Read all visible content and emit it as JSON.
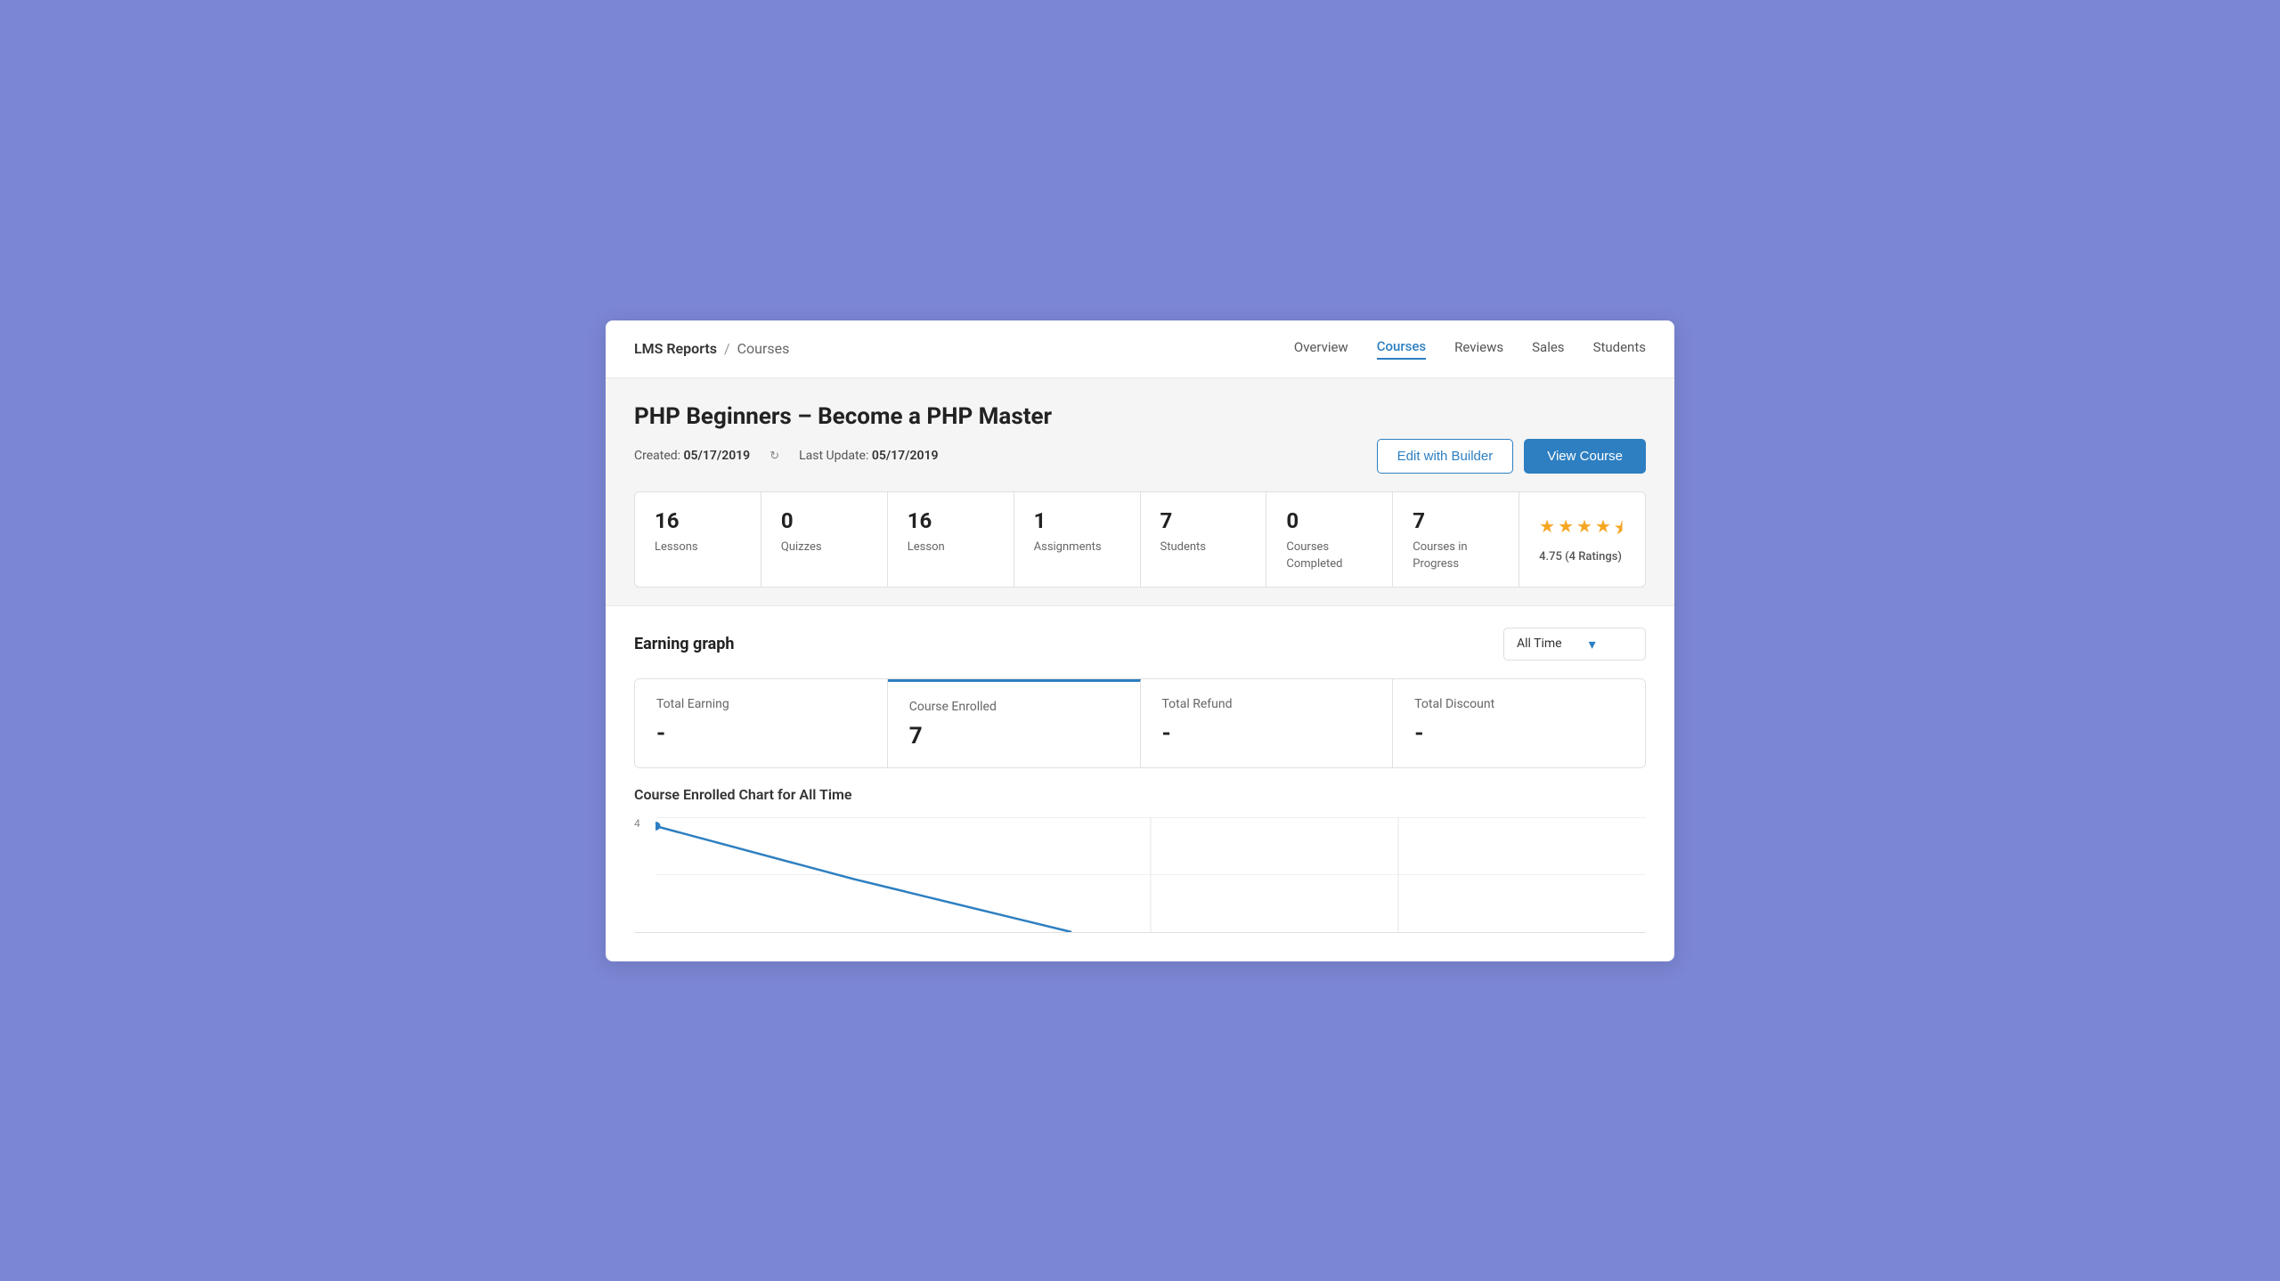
{
  "app": {
    "title": "LMS Reports",
    "separator": "/",
    "sub": "Courses"
  },
  "nav": {
    "links": [
      {
        "label": "Overview",
        "active": false
      },
      {
        "label": "Courses",
        "active": true
      },
      {
        "label": "Reviews",
        "active": false
      },
      {
        "label": "Sales",
        "active": false
      },
      {
        "label": "Students",
        "active": false
      }
    ]
  },
  "course": {
    "title": "PHP Beginners – Become a PHP Master",
    "created_label": "Created:",
    "created_date": "05/17/2019",
    "last_update_label": "Last Update:",
    "last_update_date": "05/17/2019",
    "edit_button": "Edit with Builder",
    "view_button": "View Course"
  },
  "stats": [
    {
      "number": "16",
      "label": "Lessons"
    },
    {
      "number": "0",
      "label": "Quizzes"
    },
    {
      "number": "16",
      "label": "Lesson"
    },
    {
      "number": "1",
      "label": "Assignments"
    },
    {
      "number": "7",
      "label": "Students"
    },
    {
      "number": "0",
      "label": "Courses Completed"
    },
    {
      "number": "7",
      "label": "Courses in Progress"
    }
  ],
  "rating": {
    "value": 4.75,
    "count": 4,
    "text": "4.75 (4 Ratings)",
    "stars": [
      1,
      1,
      1,
      1,
      0.5
    ]
  },
  "earning_graph": {
    "title": "Earning graph",
    "dropdown_label": "All Time",
    "chart_title": "Course Enrolled Chart for All Time",
    "y_label": "4"
  },
  "metrics": [
    {
      "label": "Total Earning",
      "value": "-",
      "active": false
    },
    {
      "label": "Course Enrolled",
      "value": "7",
      "active": true
    },
    {
      "label": "Total Refund",
      "value": "-",
      "active": false
    },
    {
      "label": "Total Discount",
      "value": "-",
      "active": false
    }
  ]
}
